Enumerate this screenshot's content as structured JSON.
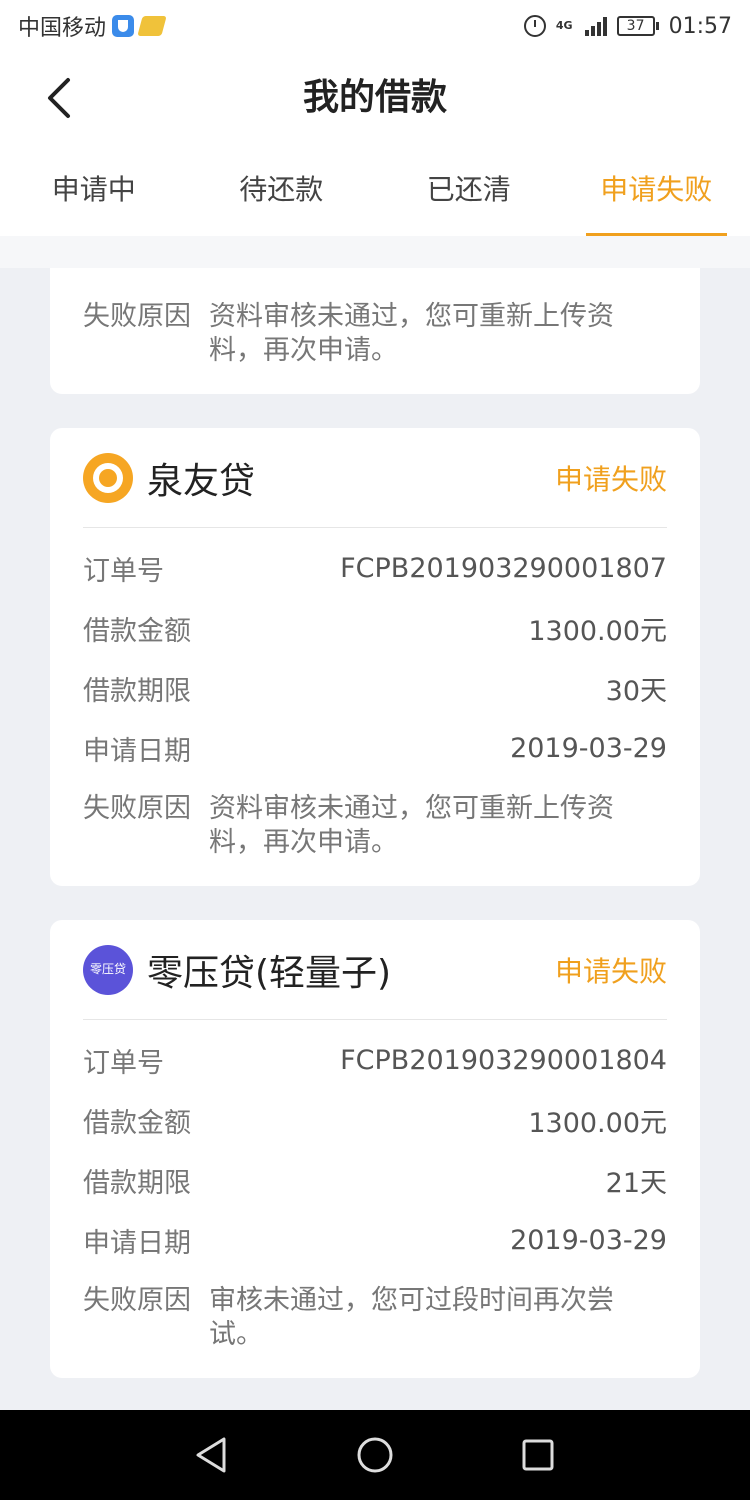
{
  "status_bar": {
    "carrier": "中国移动",
    "network": "4G",
    "battery": "37",
    "time": "01:57"
  },
  "header": {
    "title": "我的借款"
  },
  "tabs": [
    {
      "label": "申请中"
    },
    {
      "label": "待还款"
    },
    {
      "label": "已还清"
    },
    {
      "label": "申请失败",
      "active": true
    }
  ],
  "labels": {
    "order_no": "订单号",
    "amount": "借款金额",
    "term": "借款期限",
    "date": "申请日期",
    "reason": "失败原因"
  },
  "partial_card": {
    "reason_value": "资料审核未通过，您可重新上传资料，再次申请。"
  },
  "loans": [
    {
      "lender": "泉友贷",
      "status": "申请失败",
      "order_no": "FCPB201903290001807",
      "amount": "1300.00元",
      "term": "30天",
      "date": "2019-03-29",
      "reason": "资料审核未通过，您可重新上传资料，再次申请。"
    },
    {
      "lender": "零压贷(轻量子)",
      "logo_text": "零压贷",
      "status": "申请失败",
      "order_no": "FCPB201903290001804",
      "amount": "1300.00元",
      "term": "21天",
      "date": "2019-03-29",
      "reason": "审核未通过，您可过段时间再次尝试。"
    }
  ],
  "colors": {
    "accent": "#f0a01e",
    "background": "#eef0f4",
    "card": "#ffffff"
  }
}
